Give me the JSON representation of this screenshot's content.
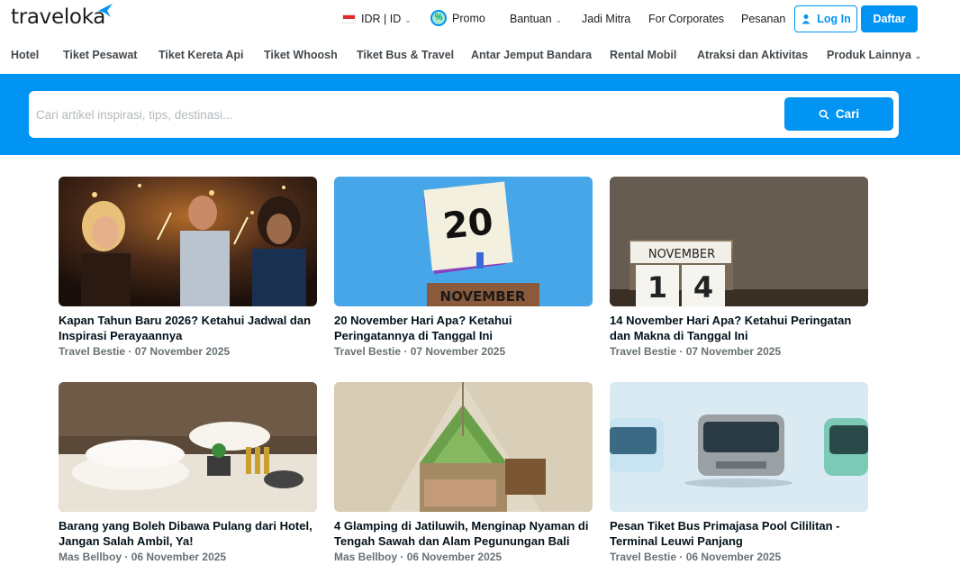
{
  "header": {
    "logo_text": "traveloka",
    "currency_label": "IDR | ID",
    "promo_label": "Promo",
    "bantuan_label": "Bantuan",
    "jadi_mitra_label": "Jadi Mitra",
    "corporates_label": "For Corporates",
    "pesanan_label": "Pesanan",
    "login_label": "Log In",
    "daftar_label": "Daftar"
  },
  "categories": [
    "Hotel",
    "Tiket Pesawat",
    "Tiket Kereta Api",
    "Tiket Whoosh",
    "Tiket Bus & Travel",
    "Antar Jemput Bandara",
    "Rental Mobil",
    "Atraksi dan Aktivitas",
    "Produk Lainnya"
  ],
  "search": {
    "placeholder": "Cari artikel inspirasi, tips, destinasi...",
    "button_label": "Cari"
  },
  "articles": [
    {
      "title": "Kapan Tahun Baru 2026? Ketahui Jadwal dan Inspirasi Perayaannya",
      "author": "Travel Bestie",
      "date": "07 November 2025",
      "image": "party-celebration"
    },
    {
      "title": "20 November Hari Apa? Ketahui Peringatannya di Tanggal Ini",
      "author": "Travel Bestie",
      "date": "07 November 2025",
      "image": "calendar-20-november"
    },
    {
      "title": "14 November Hari Apa? Ketahui Peringatan dan Makna di Tanggal Ini",
      "author": "Travel Bestie",
      "date": "07 November 2025",
      "image": "calendar-14-november"
    },
    {
      "title": "Barang yang Boleh Dibawa Pulang dari Hotel, Jangan Salah Ambil, Ya!",
      "author": "Mas Bellboy",
      "date": "06 November 2025",
      "image": "hotel-towels"
    },
    {
      "title": "4 Glamping di Jatiluwih, Menginap Nyaman di Tengah Sawah dan Alam Pegunungan Bali",
      "author": "Mas Bellboy",
      "date": "06 November 2025",
      "image": "glamping-tent"
    },
    {
      "title": "Pesan Tiket Bus Primajasa Pool Cililitan - Terminal Leuwi Panjang",
      "author": "Travel Bestie",
      "date": "06 November 2025",
      "image": "buses"
    }
  ],
  "image_text": {
    "cal_num_20": "20",
    "cal_month_20": "NOVEMBER",
    "cal_month_14": "NOVEMBER",
    "cal_digit_1": "1",
    "cal_digit_4": "4"
  },
  "colors": {
    "brand": "#0194f3",
    "text": "#03121a",
    "meta": "#687176"
  }
}
